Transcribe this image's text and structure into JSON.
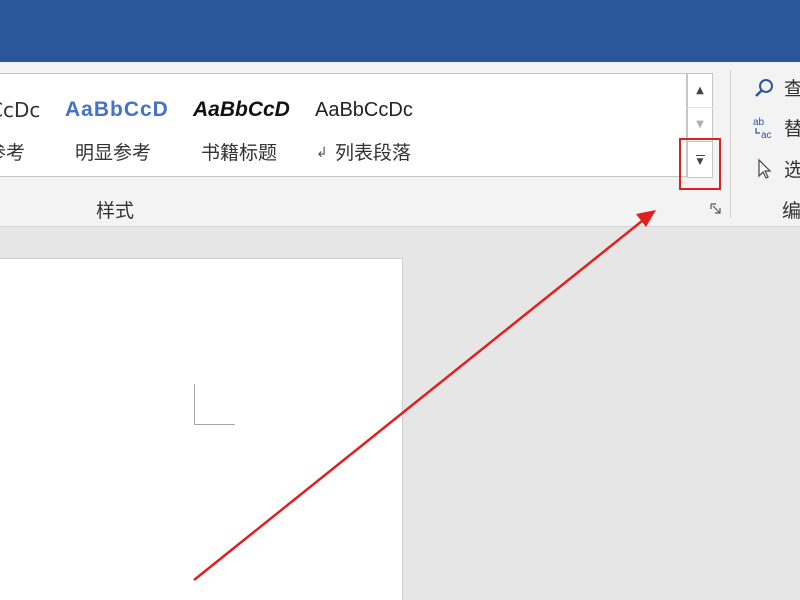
{
  "ribbon": {
    "styles_gallery": {
      "samples": [
        "CcDc",
        "AaBbCcD",
        "AaBbCcD",
        "AaBbCcDc"
      ],
      "names": [
        "参考",
        "明显参考",
        "书籍标题",
        "列表段落"
      ],
      "paragraph_mark": "↲"
    },
    "styles_group_label": "样式",
    "editing_group": {
      "label": "编",
      "items": [
        {
          "icon": "search-icon",
          "label": "查"
        },
        {
          "icon": "replace-icon",
          "label": "替"
        },
        {
          "icon": "select-cursor-icon",
          "label": "选"
        }
      ]
    }
  },
  "colors": {
    "title_bar": "#2b579a",
    "annotation": "#e02020",
    "intense_reference": "#4472c4"
  }
}
